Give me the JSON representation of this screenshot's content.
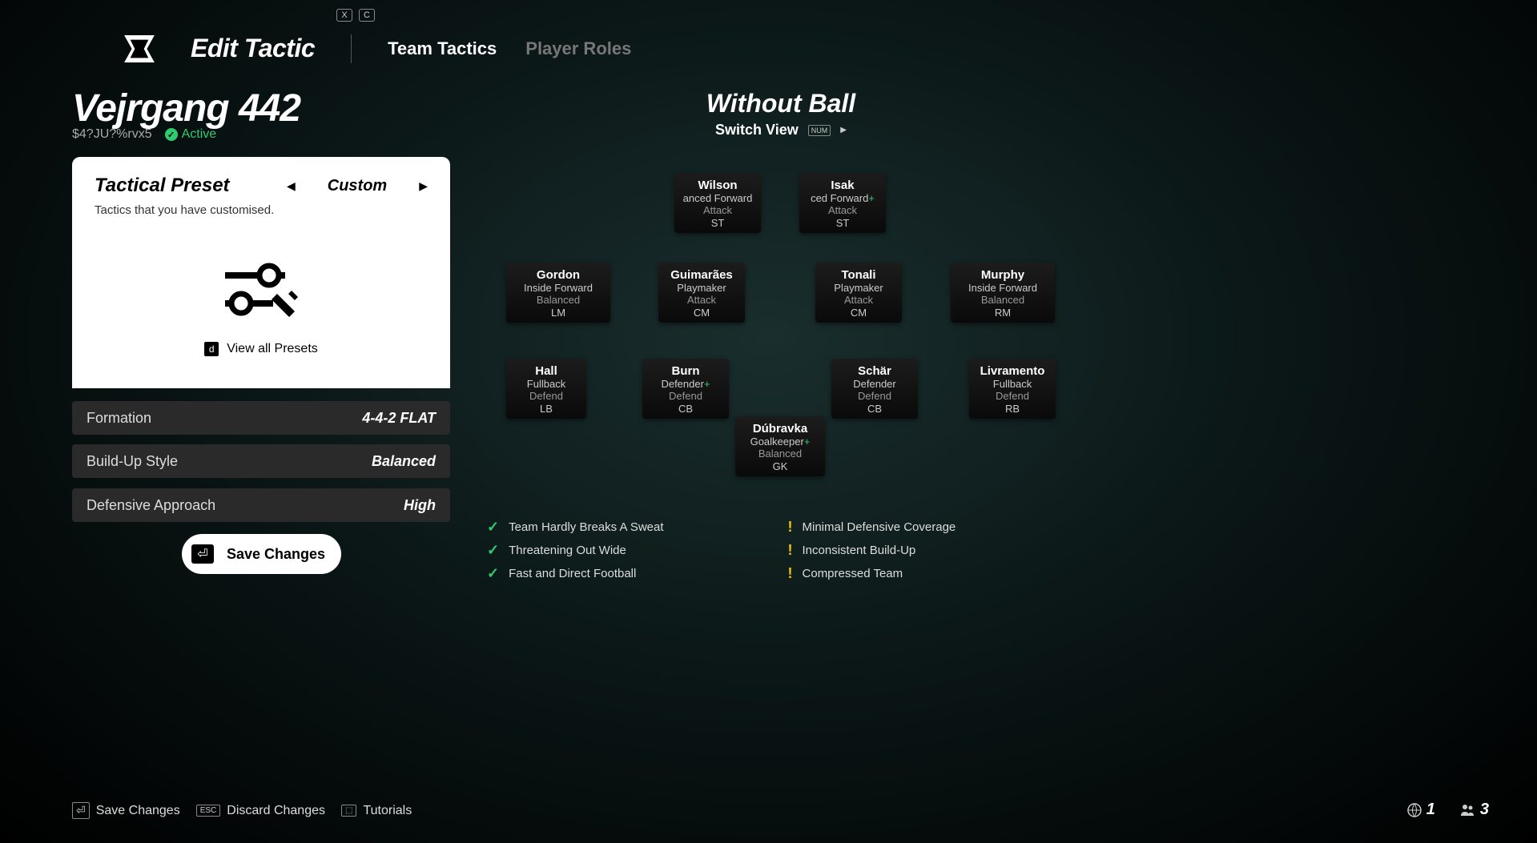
{
  "keys": {
    "x": "X",
    "c": "C"
  },
  "header": {
    "title": "Edit Tactic",
    "tab1": "Team Tactics",
    "tab2": "Player Roles"
  },
  "tactic": {
    "name": "Vejrgang 442",
    "code": "$4?JU?%rvx5",
    "active_label": "Active"
  },
  "preset": {
    "title": "Tactical Preset",
    "name": "Custom",
    "description": "Tactics that you have customised.",
    "view_all": "View all Presets"
  },
  "options": {
    "formation_label": "Formation",
    "formation_value": "4-4-2 FLAT",
    "buildup_label": "Build-Up Style",
    "buildup_value": "Balanced",
    "defensive_label": "Defensive Approach",
    "defensive_value": "High"
  },
  "save_label": "Save Changes",
  "pitch": {
    "title": "Without Ball",
    "switch": "Switch View"
  },
  "players": {
    "st1": {
      "name": "Wilson",
      "role": "anced Forward",
      "duty": "Attack",
      "pos": "ST"
    },
    "st2": {
      "name": "Isak",
      "role": "ced Forward",
      "duty": "Attack",
      "pos": "ST"
    },
    "lm": {
      "name": "Gordon",
      "role": "Inside Forward",
      "duty": "Balanced",
      "pos": "LM"
    },
    "cm1": {
      "name": "Guimarães",
      "role": "Playmaker",
      "duty": "Attack",
      "pos": "CM"
    },
    "cm2": {
      "name": "Tonali",
      "role": "Playmaker",
      "duty": "Attack",
      "pos": "CM"
    },
    "rm": {
      "name": "Murphy",
      "role": "Inside Forward",
      "duty": "Balanced",
      "pos": "RM"
    },
    "lb": {
      "name": "Hall",
      "role": "Fullback",
      "duty": "Defend",
      "pos": "LB"
    },
    "cb1": {
      "name": "Burn",
      "role": "Defender",
      "duty": "Defend",
      "pos": "CB"
    },
    "cb2": {
      "name": "Schär",
      "role": "Defender",
      "duty": "Defend",
      "pos": "CB"
    },
    "rb": {
      "name": "Livramento",
      "role": "Fullback",
      "duty": "Defend",
      "pos": "RB"
    },
    "gk": {
      "name": "Dúbravka",
      "role": "Goalkeeper",
      "duty": "Balanced",
      "pos": "GK"
    }
  },
  "traits_good": [
    "Team Hardly Breaks A Sweat",
    "Threatening Out Wide",
    "Fast and Direct Football"
  ],
  "traits_warn": [
    "Minimal Defensive Coverage",
    "Inconsistent Build-Up",
    "Compressed Team"
  ],
  "footer": {
    "save": "Save Changes",
    "discard": "Discard Changes",
    "tutorials": "Tutorials"
  },
  "bottom_right": {
    "num1": "1",
    "num2": "3"
  }
}
